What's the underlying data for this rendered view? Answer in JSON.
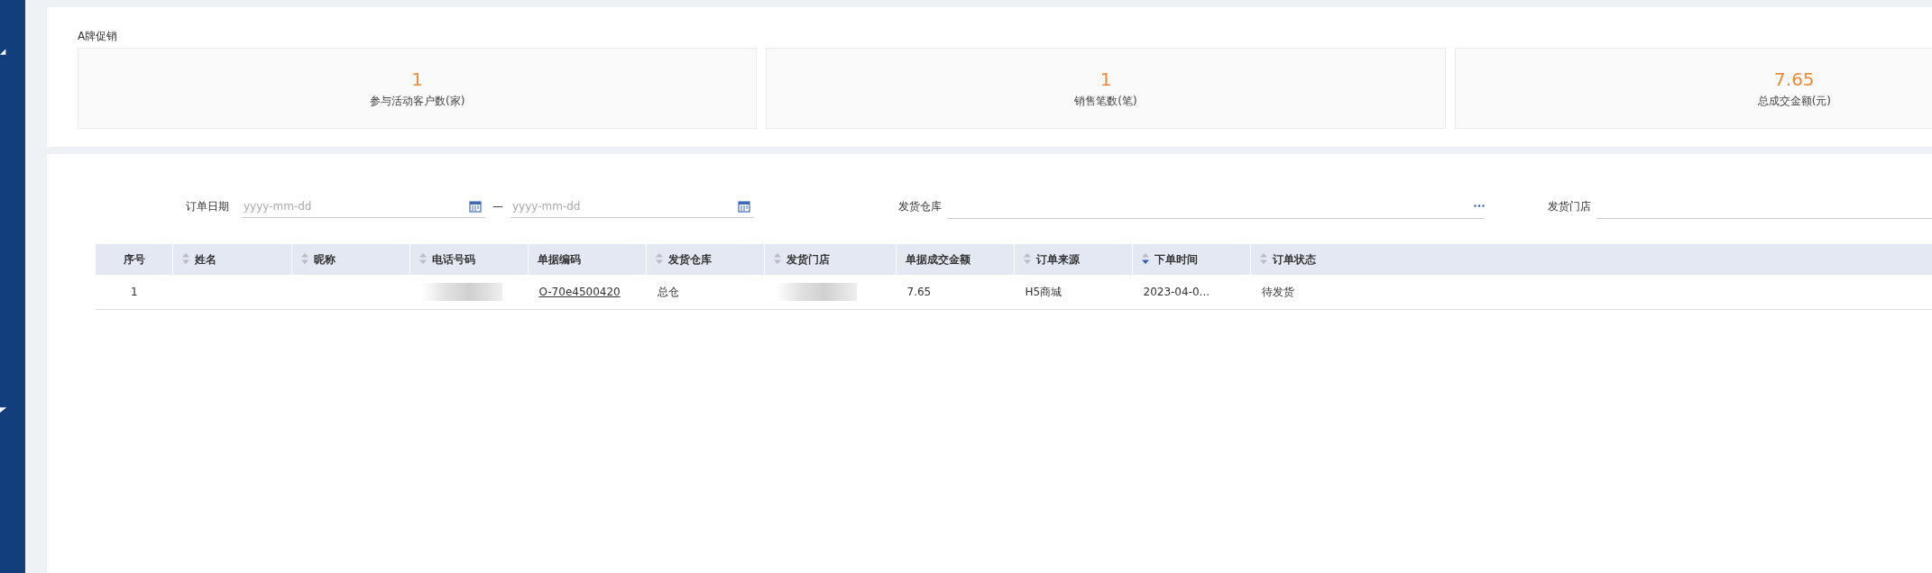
{
  "promo": {
    "title": "A牌促销",
    "stats": [
      {
        "value": "1",
        "label": "参与活动客户数(家)"
      },
      {
        "value": "1",
        "label": "销售笔数(笔)"
      },
      {
        "value": "7.65",
        "label": "总成交金额(元)"
      }
    ]
  },
  "filters": {
    "order_date": {
      "label": "订单日期",
      "from_placeholder": "yyyy-mm-dd",
      "separator": "—",
      "to_placeholder": "yyyy-mm-dd"
    },
    "warehouse": {
      "label": "发货仓库"
    },
    "store": {
      "label": "发货门店"
    }
  },
  "table": {
    "columns": [
      {
        "label": "序号",
        "sortable": false
      },
      {
        "label": "姓名",
        "sortable": true,
        "sorted_desc": false
      },
      {
        "label": "昵称",
        "sortable": true,
        "sorted_desc": false
      },
      {
        "label": "电话号码",
        "sortable": true,
        "sorted_desc": false
      },
      {
        "label": "单据编码",
        "sortable": false
      },
      {
        "label": "发货仓库",
        "sortable": true,
        "sorted_desc": false
      },
      {
        "label": "发货门店",
        "sortable": true,
        "sorted_desc": false
      },
      {
        "label": "单据成交金额",
        "sortable": false
      },
      {
        "label": "订单来源",
        "sortable": true,
        "sorted_desc": false
      },
      {
        "label": "下单时间",
        "sortable": true,
        "sorted_desc": true
      },
      {
        "label": "订单状态",
        "sortable": true,
        "sorted_desc": false
      }
    ],
    "rows": [
      {
        "cells": [
          {
            "kind": "text",
            "text": "1"
          },
          {
            "kind": "empty"
          },
          {
            "kind": "empty"
          },
          {
            "kind": "blurred"
          },
          {
            "kind": "link",
            "text": "O-70e4500420"
          },
          {
            "kind": "text",
            "text": "总仓"
          },
          {
            "kind": "blurred"
          },
          {
            "kind": "text",
            "text": "7.65"
          },
          {
            "kind": "text",
            "text": "H5商城"
          },
          {
            "kind": "text",
            "text": "2023-04-0..."
          },
          {
            "kind": "text",
            "text": "待发货"
          }
        ]
      }
    ]
  }
}
